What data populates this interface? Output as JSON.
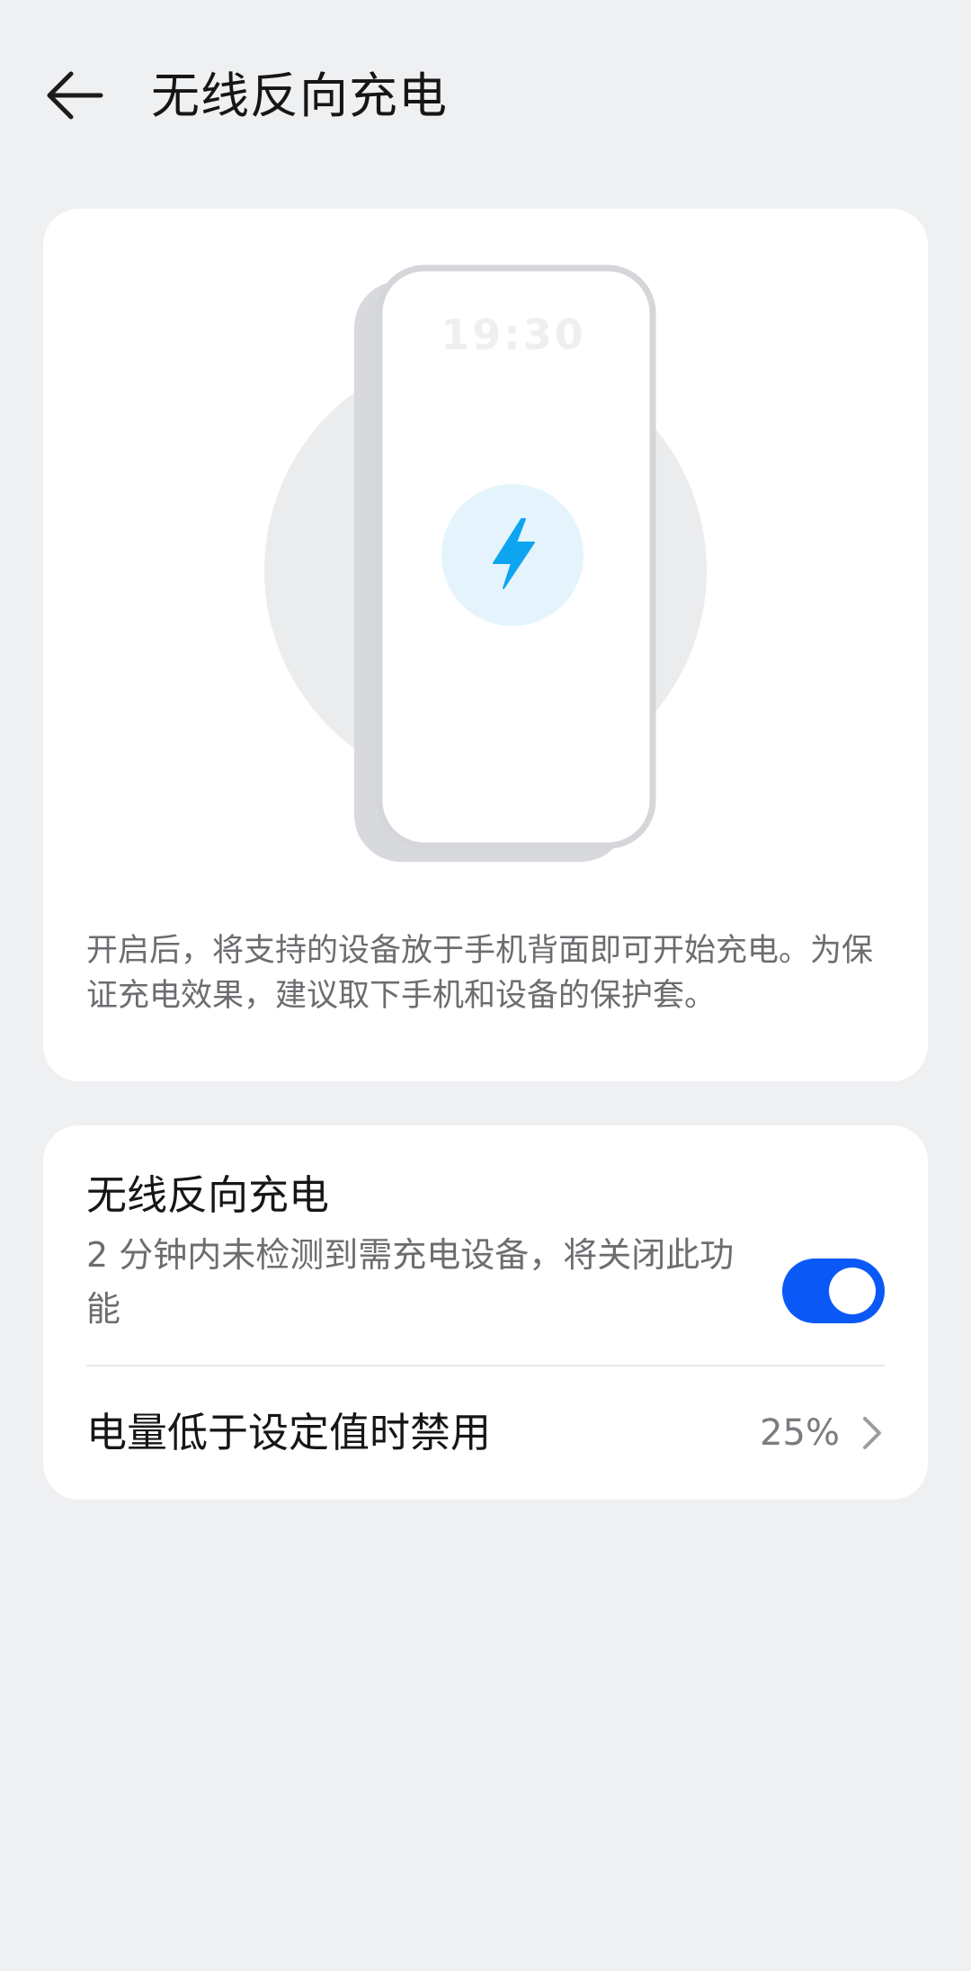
{
  "header": {
    "back_icon": "arrow-left-icon",
    "title": "无线反向充电"
  },
  "illustration": {
    "phone_time": "19:30",
    "charge_icon": "lightning-bolt-icon",
    "accent_color": "#0ea5f0"
  },
  "description": "开启后，将支持的设备放于手机背面即可开始充电。为保证充电效果，建议取下手机和设备的保护套。",
  "settings": {
    "toggle_row": {
      "title": "无线反向充电",
      "subtitle": "2 分钟内未检测到需充电设备，将关闭此功能",
      "enabled": true,
      "toggle_color": "#0a59f7"
    },
    "threshold_row": {
      "label": "电量低于设定值时禁用",
      "value": "25%",
      "chevron_icon": "chevron-right-icon"
    }
  }
}
